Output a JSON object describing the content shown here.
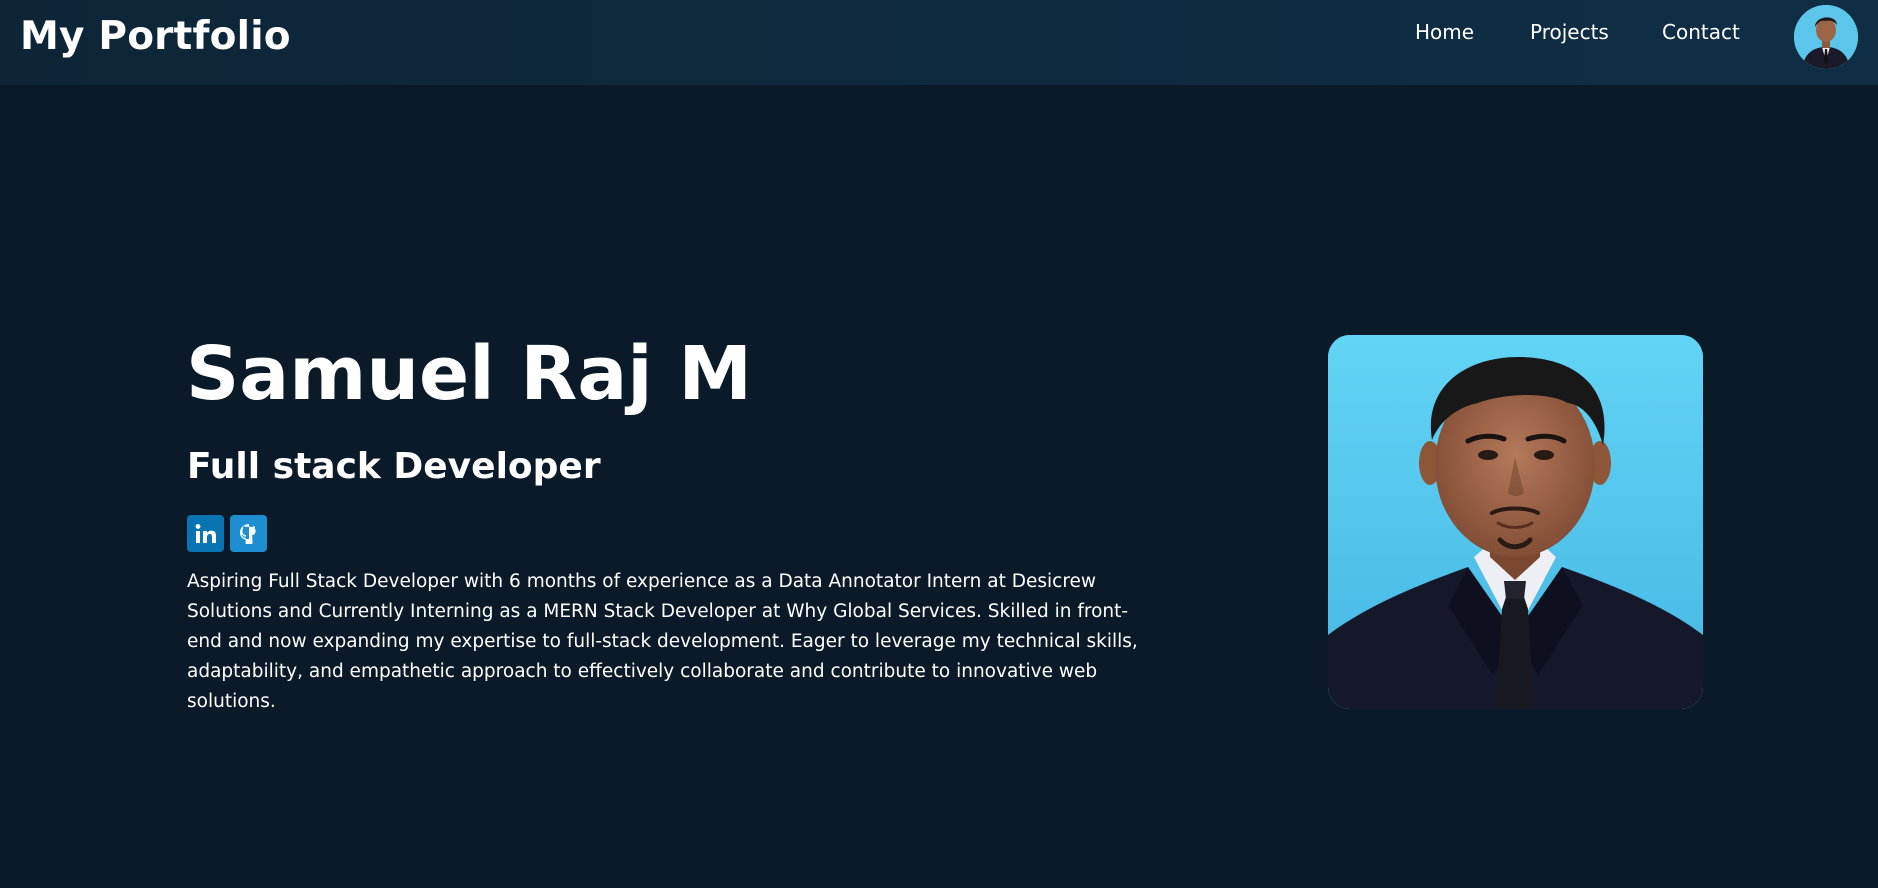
{
  "nav": {
    "brand": "My Portfolio",
    "links": [
      {
        "label": "Home"
      },
      {
        "label": "Projects"
      },
      {
        "label": "Contact"
      }
    ],
    "avatar_alt": "profile avatar"
  },
  "hero": {
    "name": "Samuel Raj M",
    "role": "Full stack Developer",
    "socials": [
      {
        "icon": "linkedin-icon",
        "label": "in"
      },
      {
        "icon": "github-icon"
      }
    ],
    "bio": "Aspiring Full Stack Developer with 6 months of experience as a Data Annotator Intern at Desicrew Solutions and Currently Interning as a MERN Stack Developer at Why Global Services. Skilled in front-end and now expanding my expertise to full-stack development. Eager to leverage my technical skills, adaptability, and empathetic approach to effectively collaborate and contribute to innovative web solutions."
  },
  "colors": {
    "background": "#0a1a28",
    "navbar": "#0f2e45",
    "photo_background": "#5fd0f2",
    "linkedin": "#0a73b1",
    "github": "#1d8fd0"
  }
}
